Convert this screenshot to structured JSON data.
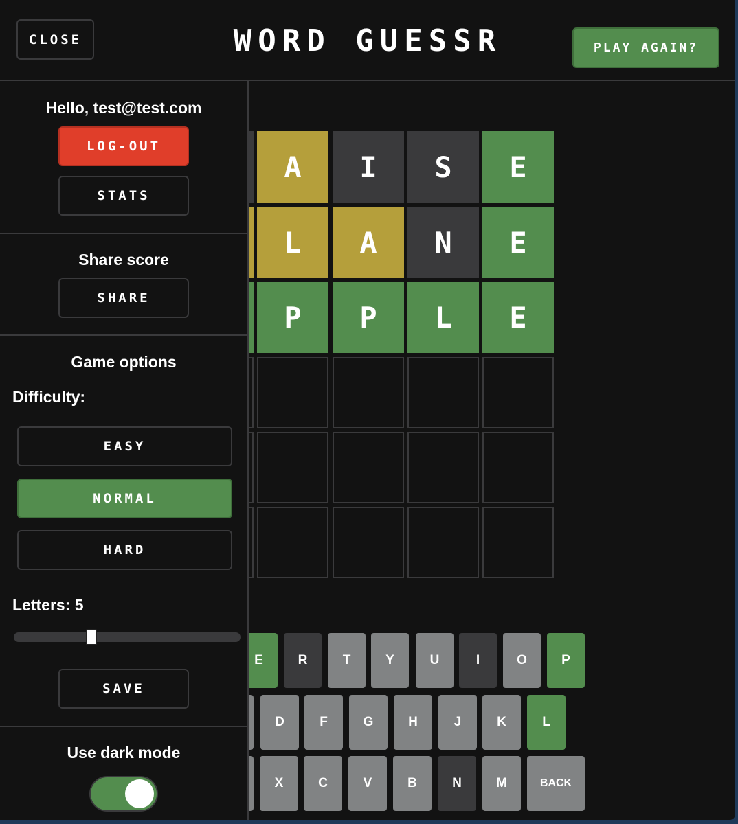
{
  "header": {
    "close_label": "CLOSE",
    "title": "WORD GUESSR",
    "play_again_label": "PLAY AGAIN?"
  },
  "board": {
    "rows": [
      [
        {
          "letter": "",
          "state": "absent"
        },
        {
          "letter": "A",
          "state": "present"
        },
        {
          "letter": "I",
          "state": "absent"
        },
        {
          "letter": "S",
          "state": "absent"
        },
        {
          "letter": "E",
          "state": "correct"
        }
      ],
      [
        {
          "letter": "",
          "state": "present"
        },
        {
          "letter": "L",
          "state": "present"
        },
        {
          "letter": "A",
          "state": "present"
        },
        {
          "letter": "N",
          "state": "absent"
        },
        {
          "letter": "E",
          "state": "correct"
        }
      ],
      [
        {
          "letter": "",
          "state": "correct"
        },
        {
          "letter": "P",
          "state": "correct"
        },
        {
          "letter": "P",
          "state": "correct"
        },
        {
          "letter": "L",
          "state": "correct"
        },
        {
          "letter": "E",
          "state": "correct"
        }
      ],
      [
        {
          "letter": "",
          "state": "empty"
        },
        {
          "letter": "",
          "state": "empty"
        },
        {
          "letter": "",
          "state": "empty"
        },
        {
          "letter": "",
          "state": "empty"
        },
        {
          "letter": "",
          "state": "empty"
        }
      ],
      [
        {
          "letter": "",
          "state": "empty"
        },
        {
          "letter": "",
          "state": "empty"
        },
        {
          "letter": "",
          "state": "empty"
        },
        {
          "letter": "",
          "state": "empty"
        },
        {
          "letter": "",
          "state": "empty"
        }
      ],
      [
        {
          "letter": "",
          "state": "empty"
        },
        {
          "letter": "",
          "state": "empty"
        },
        {
          "letter": "",
          "state": "empty"
        },
        {
          "letter": "",
          "state": "empty"
        },
        {
          "letter": "",
          "state": "empty"
        }
      ]
    ]
  },
  "keyboard": {
    "rows": [
      [
        {
          "key": "E",
          "state": "correct"
        },
        {
          "key": "R",
          "state": "absent"
        },
        {
          "key": "T",
          "state": "unused"
        },
        {
          "key": "Y",
          "state": "unused"
        },
        {
          "key": "U",
          "state": "unused"
        },
        {
          "key": "I",
          "state": "absent"
        },
        {
          "key": "O",
          "state": "unused"
        },
        {
          "key": "P",
          "state": "correct"
        }
      ],
      [
        {
          "key": "",
          "state": "unused"
        },
        {
          "key": "D",
          "state": "unused"
        },
        {
          "key": "F",
          "state": "unused"
        },
        {
          "key": "G",
          "state": "unused"
        },
        {
          "key": "H",
          "state": "unused"
        },
        {
          "key": "J",
          "state": "unused"
        },
        {
          "key": "K",
          "state": "unused"
        },
        {
          "key": "L",
          "state": "correct"
        }
      ],
      [
        {
          "key": "",
          "state": "unused"
        },
        {
          "key": "X",
          "state": "unused"
        },
        {
          "key": "C",
          "state": "unused"
        },
        {
          "key": "V",
          "state": "unused"
        },
        {
          "key": "B",
          "state": "unused"
        },
        {
          "key": "N",
          "state": "absent"
        },
        {
          "key": "M",
          "state": "unused"
        },
        {
          "key": "BACK",
          "state": "unused"
        }
      ]
    ]
  },
  "sidebar": {
    "greeting": "Hello, test@test.com",
    "logout_label": "LOG-OUT",
    "stats_label": "STATS",
    "share_heading": "Share score",
    "share_label": "SHARE",
    "options_heading": "Game options",
    "difficulty_label": "Difficulty:",
    "difficulty_options": [
      "EASY",
      "NORMAL",
      "HARD"
    ],
    "difficulty_selected": "NORMAL",
    "letters_label": "Letters: 5",
    "letters_value": 5,
    "save_label": "SAVE",
    "dark_mode_label": "Use dark mode",
    "dark_mode_on": true
  },
  "colors": {
    "correct": "#538d4e",
    "present": "#b59f3b",
    "absent": "#3a3a3c",
    "unused_key": "#818384",
    "logout": "#e03e2a",
    "background": "#121212"
  }
}
